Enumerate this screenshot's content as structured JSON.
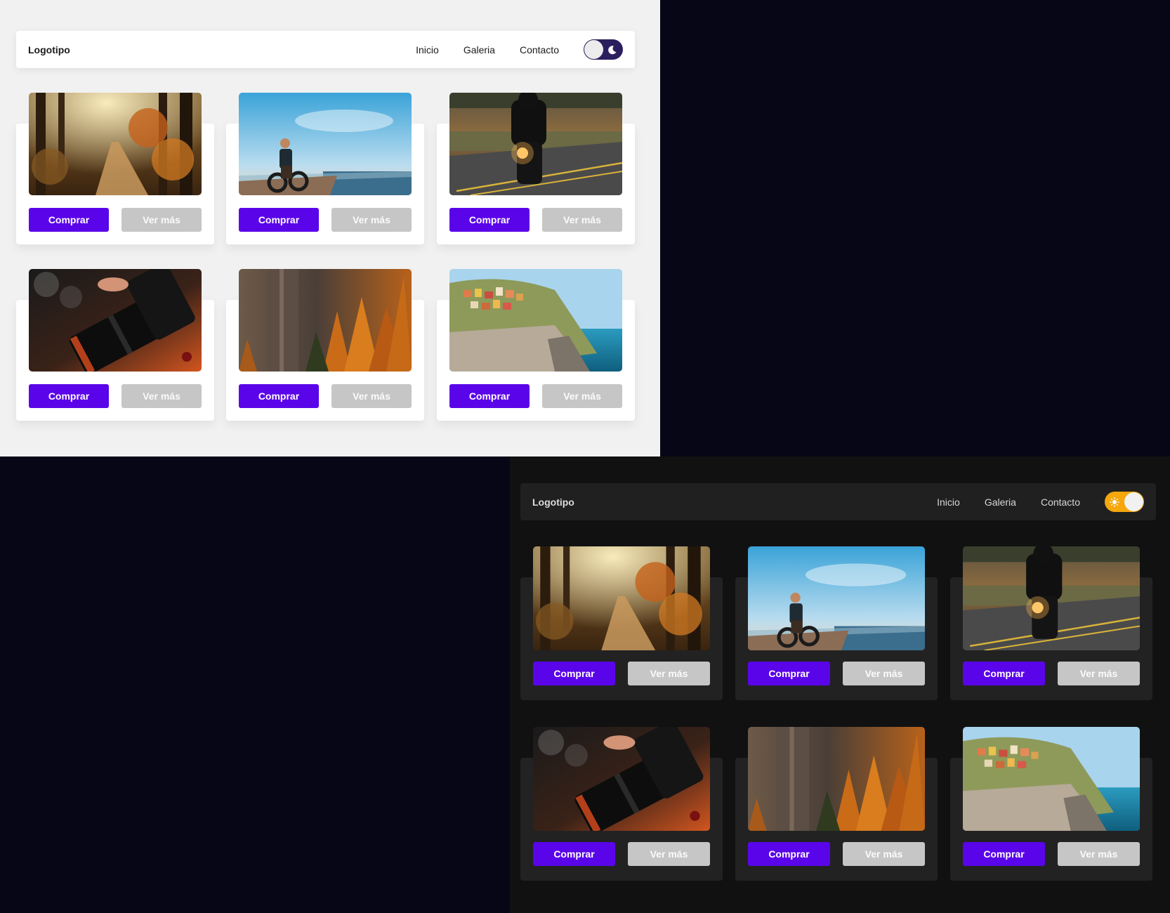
{
  "themes": {
    "light": {
      "name": "light",
      "toggle_icon": "moon-icon",
      "toggle_color": "#2c1f5e"
    },
    "dark": {
      "name": "dark",
      "toggle_icon": "sun-icon",
      "toggle_color": "#f5a70c"
    }
  },
  "navbar": {
    "logo": "Logotipo",
    "links": [
      "Inicio",
      "Galeria",
      "Contacto"
    ]
  },
  "cards": [
    {
      "image": "forest-path-photo",
      "buy_label": "Comprar",
      "more_label": "Ver más"
    },
    {
      "image": "cyclist-beach-photo",
      "buy_label": "Comprar",
      "more_label": "Ver más"
    },
    {
      "image": "motorcycle-road-photo",
      "buy_label": "Comprar",
      "more_label": "Ver más"
    },
    {
      "image": "camera-lens-photo",
      "buy_label": "Comprar",
      "more_label": "Ver más"
    },
    {
      "image": "autumn-cliff-photo",
      "buy_label": "Comprar",
      "more_label": "Ver más"
    },
    {
      "image": "coastal-village-photo",
      "buy_label": "Comprar",
      "more_label": "Ver más"
    }
  ],
  "colors": {
    "accent": "#5a05e9",
    "secondary_button": "#c6c6c6",
    "light_background": "#f1f1f1",
    "dark_background": "#111111",
    "page_background": "#070617"
  }
}
